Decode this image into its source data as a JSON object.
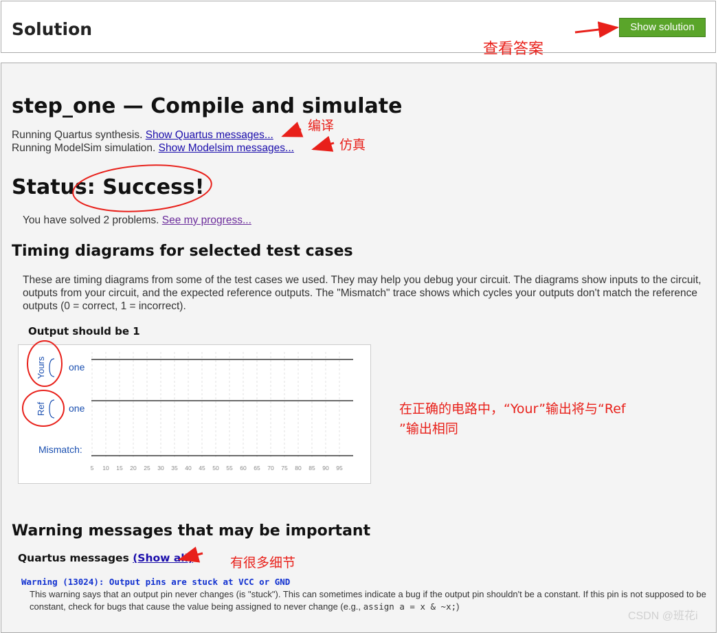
{
  "solution": {
    "title": "Solution",
    "button": "Show solution"
  },
  "step": {
    "title": "step_one — Compile and simulate",
    "quartus_prefix": "Running Quartus synthesis.",
    "quartus_link": "Show Quartus messages...",
    "modelsim_prefix": "Running ModelSim simulation.",
    "modelsim_link": "Show Modelsim messages..."
  },
  "status": {
    "heading": "Status: Success!",
    "progress_prefix": "You have solved 2 problems.",
    "progress_link": "See my progress..."
  },
  "timing": {
    "heading": "Timing diagrams for selected test cases",
    "description": "These are timing diagrams from some of the test cases we used. They may help you debug your circuit. The diagrams show inputs to the circuit, outputs from your circuit, and the expected reference outputs. The \"Mismatch\" trace shows which cycles your outputs don't match the reference outputs (0 = correct, 1 = incorrect).",
    "case_title": "Output should be 1",
    "yours_label": "Yours",
    "ref_label": "Ref",
    "yours_signal": "one",
    "ref_signal": "one",
    "mismatch_label": "Mismatch:",
    "ticks": [
      "5",
      "10",
      "15",
      "20",
      "25",
      "30",
      "35",
      "40",
      "45",
      "50",
      "55",
      "60",
      "65",
      "70",
      "75",
      "80",
      "85",
      "90",
      "95"
    ]
  },
  "warnings": {
    "heading": "Warning messages that may be important",
    "quartus_label": "Quartus messages",
    "show_all": "(Show all)",
    "code": "Warning (13024): Output pins are stuck at VCC or GND",
    "text_1": "This warning says that an output pin never changes (is \"stuck\"). This can sometimes indicate a bug if the output pin shouldn't be a constant. If this pin is not supposed to be constant, check for bugs that cause the value being assigned to never change (e.g., ",
    "text_code": "assign a = x & ~x;",
    "text_2": ")"
  },
  "annotations": {
    "answer": "查看答案",
    "compile": "编译",
    "simulate": "仿真",
    "note_line1": "在正确的电路中，“Your”输出将与“Ref",
    "note_line2": "”输出相同",
    "details": "有很多细节",
    "accent_color": "#e8201a"
  },
  "watermark": "CSDN @班花i",
  "colors": {
    "button_green": "#5aa52a",
    "link_blue": "#1a0dab",
    "signal_blue": "#1a4fb0"
  }
}
